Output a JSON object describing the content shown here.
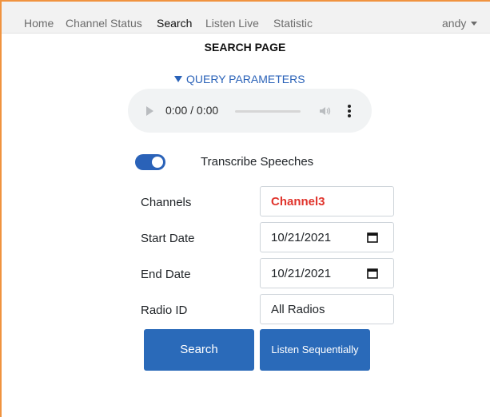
{
  "nav": {
    "items": [
      {
        "label": "Home"
      },
      {
        "label": "Channel Status"
      },
      {
        "label": "Search"
      },
      {
        "label": "Listen Live"
      },
      {
        "label": "Statistic"
      }
    ],
    "active": "Search",
    "user": "andy"
  },
  "page": {
    "title": "SEARCH PAGE",
    "query_toggle": "QUERY PARAMETERS"
  },
  "player": {
    "time": "0:00 / 0:00"
  },
  "transcribe": {
    "label": "Transcribe Speeches",
    "enabled": true
  },
  "form": {
    "channels": {
      "label": "Channels",
      "value": "Channel3"
    },
    "start_date": {
      "label": "Start Date",
      "value": "10/21/2021"
    },
    "end_date": {
      "label": "End Date",
      "value": "10/21/2021"
    },
    "radio_id": {
      "label": "Radio ID",
      "value": "All Radios"
    }
  },
  "buttons": {
    "search": "Search",
    "listen_sequentially": "Listen Sequentially"
  },
  "colors": {
    "accent": "#2a62b8",
    "button": "#2a6ab9",
    "channel_highlight": "#e0342c",
    "frame_border": "#f0933f"
  }
}
